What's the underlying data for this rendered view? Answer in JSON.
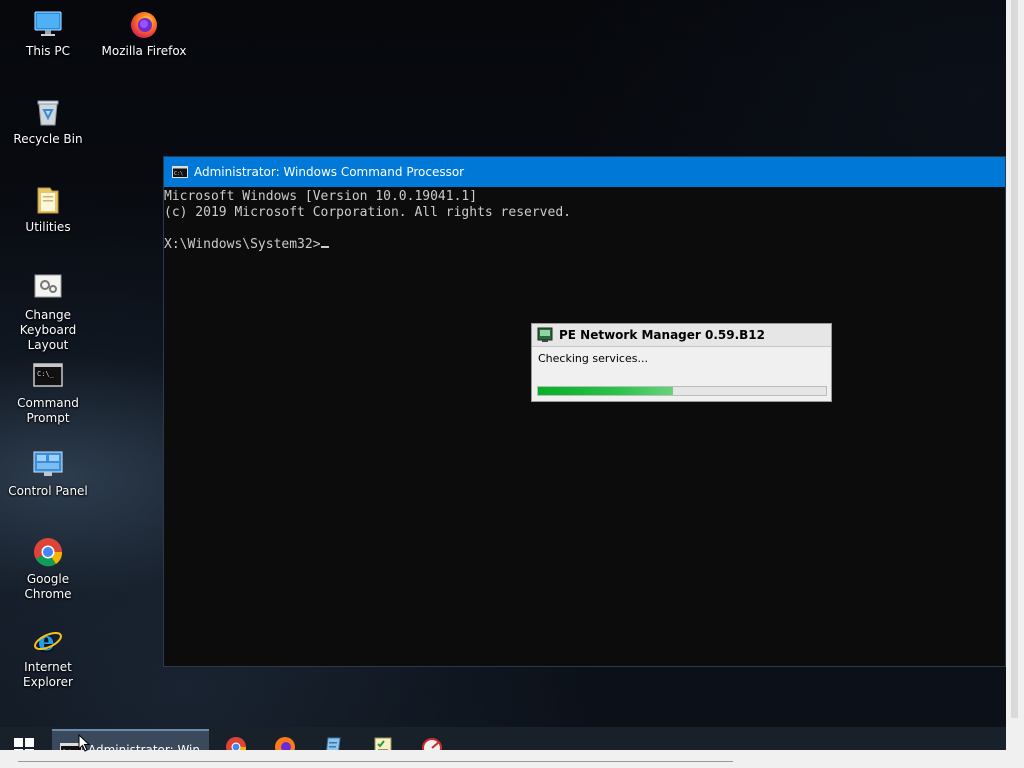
{
  "desktop": {
    "icons": [
      {
        "label": "This PC",
        "icon": "this-pc-icon"
      },
      {
        "label": "Mozilla Firefox",
        "icon": "firefox-icon"
      },
      {
        "label": "Recycle Bin",
        "icon": "recycle-bin-icon"
      },
      {
        "label": "Utilities",
        "icon": "folder-icon"
      },
      {
        "label_line1": "Change",
        "label_line2": "Keyboard Layout",
        "icon": "keyboard-settings-icon"
      },
      {
        "label_line1": "Command",
        "label_line2": "Prompt",
        "icon": "command-prompt-icon"
      },
      {
        "label": "Control Panel",
        "icon": "control-panel-icon"
      },
      {
        "label": "Google Chrome",
        "icon": "chrome-icon"
      },
      {
        "label": "Internet Explorer",
        "icon": "internet-explorer-icon"
      }
    ]
  },
  "cmd": {
    "title": "Administrator: Windows Command Processor",
    "line1": "Microsoft Windows [Version 10.0.19041.1]",
    "line2": "(c) 2019 Microsoft Corporation. All rights reserved.",
    "prompt": "X:\\Windows\\System32>",
    "colors": {
      "titlebar": "#0078d7",
      "background": "#0c0c0c",
      "text": "#cccccc"
    }
  },
  "pe_dialog": {
    "title": "PE Network Manager 0.59.B12",
    "status": "Checking services...",
    "progress": 0.47,
    "progress_color": "#06b025"
  },
  "taskbar": {
    "active_task_label": "Administrator: Win...",
    "pinned": [
      "chrome-icon",
      "firefox-icon",
      "notepad-icon",
      "task-list-icon",
      "disk-utility-icon"
    ]
  }
}
